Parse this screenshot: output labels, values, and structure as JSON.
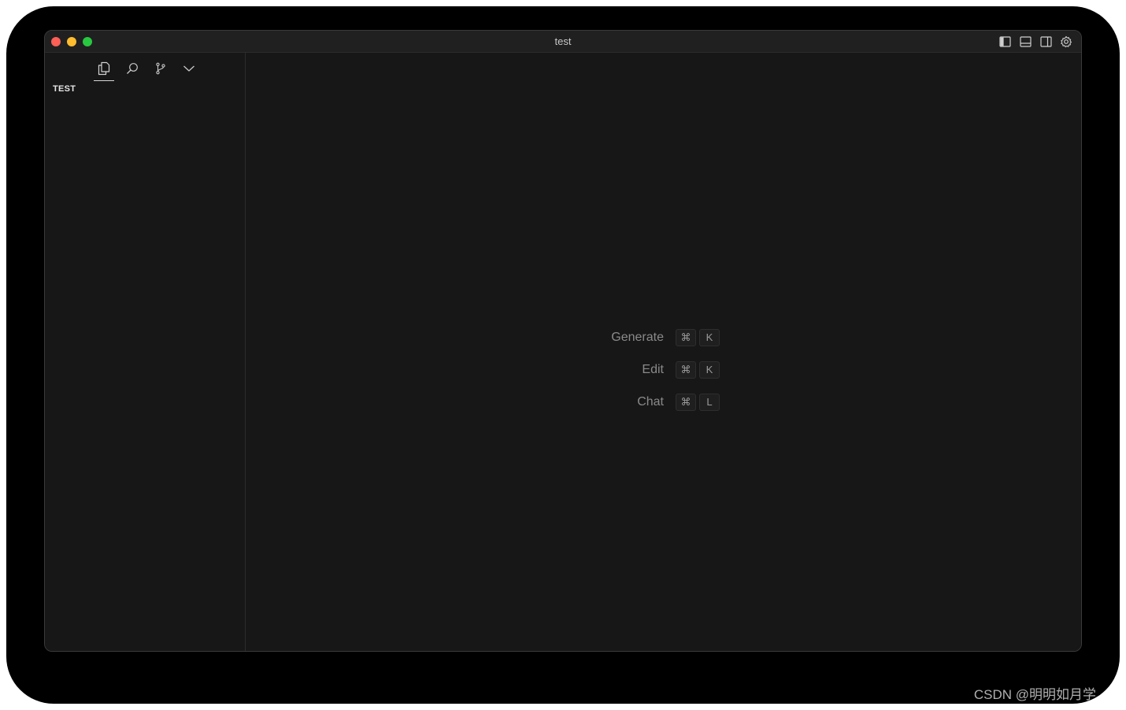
{
  "window": {
    "title": "test"
  },
  "sidebar": {
    "tabs": [
      {
        "name": "explorer",
        "icon": "files-icon",
        "active": true
      },
      {
        "name": "search",
        "icon": "search-icon",
        "active": false
      },
      {
        "name": "source-control",
        "icon": "source-control-icon",
        "active": false
      },
      {
        "name": "more",
        "icon": "chevron-down-icon",
        "active": false
      }
    ],
    "folder_title": "TEST"
  },
  "title_actions": [
    "toggle-primary-sidebar-icon",
    "toggle-panel-icon",
    "toggle-secondary-sidebar-icon",
    "settings-gear-icon"
  ],
  "editor": {
    "shortcuts": [
      {
        "label": "Generate",
        "keys": [
          "⌘",
          "K"
        ]
      },
      {
        "label": "Edit",
        "keys": [
          "⌘",
          "K"
        ]
      },
      {
        "label": "Chat",
        "keys": [
          "⌘",
          "L"
        ]
      }
    ]
  },
  "watermark": "CSDN @明明如月学",
  "colors": {
    "background": "#171717",
    "titlebar": "#202020",
    "close": "#fe5f57",
    "minimize": "#febc2e",
    "maximize": "#28c840"
  }
}
